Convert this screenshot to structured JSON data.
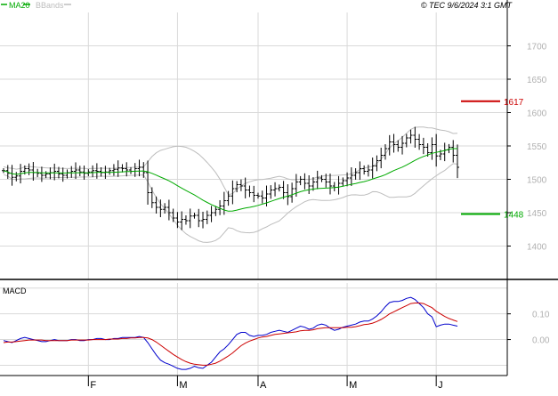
{
  "header": {
    "legend": [
      {
        "label": "MA20",
        "color": "#00aa00"
      },
      {
        "label": "BBands",
        "color": "#bdbdbd"
      }
    ],
    "timestamp": "© TEC 9/6/2024 3:1 GMT"
  },
  "colors": {
    "price": "#000000",
    "ma20": "#00aa00",
    "bands": "#bdbdbd",
    "resistance": "#cc0000",
    "support": "#00aa00",
    "macd_line": "#0000cc",
    "signal_line": "#cc0000",
    "grid": "#d9d9d9"
  },
  "chart_data": [
    {
      "type": "ohlc",
      "ylim": [
        1350,
        1750
      ],
      "yticks": [
        "1400",
        "1450",
        "1500",
        "1550",
        "1600",
        "1650",
        "1700"
      ],
      "xticks": [
        "F",
        "M",
        "A",
        "M",
        "J"
      ],
      "close": [
        1513,
        1509,
        1503,
        1505,
        1512,
        1516,
        1514,
        1510,
        1509,
        1506,
        1508,
        1510,
        1512,
        1508,
        1506,
        1510,
        1512,
        1514,
        1511,
        1509,
        1511,
        1513,
        1512,
        1510,
        1511,
        1513,
        1515,
        1517,
        1516,
        1514,
        1512,
        1516,
        1518,
        1510,
        1480,
        1465,
        1458,
        1455,
        1458,
        1450,
        1442,
        1436,
        1440,
        1438,
        1445,
        1446,
        1438,
        1440,
        1446,
        1450,
        1455,
        1460,
        1468,
        1475,
        1486,
        1492,
        1490,
        1484,
        1480,
        1476,
        1475,
        1472,
        1478,
        1484,
        1486,
        1488,
        1480,
        1474,
        1486,
        1496,
        1500,
        1494,
        1490,
        1496,
        1502,
        1500,
        1496,
        1490,
        1488,
        1494,
        1498,
        1502,
        1506,
        1510,
        1516,
        1512,
        1514,
        1520,
        1528,
        1536,
        1546,
        1556,
        1552,
        1548,
        1554,
        1562,
        1566,
        1560,
        1552,
        1548,
        1540,
        1552,
        1535,
        1538,
        1544,
        1548,
        1536,
        1518
      ],
      "annotations": [
        {
          "label": "1617",
          "value": 1617,
          "color": "#cc0000"
        },
        {
          "label": "1448",
          "value": 1448,
          "color": "#00aa00"
        }
      ],
      "legend": [
        "MA20",
        "BBands"
      ]
    },
    {
      "type": "line",
      "title": "MACD",
      "ylim": [
        -70,
        110
      ],
      "yticks": [
        "0.00",
        "0.10"
      ],
      "series": [
        {
          "values": [
            -2,
            -4,
            -6,
            -2,
            2,
            4,
            2,
            0,
            -2,
            -4,
            -4,
            -2,
            0,
            -2,
            -2,
            -2,
            0,
            0,
            -2,
            -2,
            0,
            0,
            2,
            2,
            0,
            0,
            2,
            2,
            4,
            4,
            4,
            4,
            6,
            4,
            -6,
            -18,
            -30,
            -40,
            -45,
            -48,
            -52,
            -56,
            -58,
            -58,
            -56,
            -52,
            -55,
            -56,
            -50,
            -44,
            -34,
            -24,
            -18,
            -10,
            0,
            10,
            14,
            14,
            8,
            6,
            8,
            8,
            10,
            14,
            16,
            18,
            16,
            14,
            18,
            22,
            26,
            24,
            20,
            22,
            28,
            30,
            28,
            22,
            18,
            20,
            24,
            26,
            28,
            30,
            34,
            36,
            36,
            40,
            46,
            54,
            64,
            72,
            74,
            74,
            76,
            80,
            82,
            78,
            70,
            62,
            50,
            44,
            25,
            28,
            30,
            30,
            28,
            26
          ]
        },
        {
          "values": [
            -6,
            -5,
            -5,
            -4,
            -3,
            -2,
            -1,
            -1,
            -1,
            -1,
            -2,
            -2,
            -2,
            -2,
            -2,
            -2,
            -1,
            -1,
            -1,
            -1,
            -1,
            0,
            0,
            0,
            0,
            1,
            1,
            1,
            2,
            2,
            3,
            3,
            4,
            4,
            3,
            0,
            -5,
            -11,
            -17,
            -23,
            -29,
            -34,
            -39,
            -43,
            -46,
            -48,
            -49,
            -50,
            -50,
            -48,
            -46,
            -42,
            -37,
            -32,
            -26,
            -19,
            -12,
            -7,
            -3,
            0,
            3,
            5,
            6,
            8,
            10,
            11,
            12,
            13,
            14,
            15,
            17,
            18,
            18,
            19,
            21,
            22,
            23,
            23,
            23,
            23,
            23,
            24,
            24,
            25,
            27,
            29,
            30,
            32,
            35,
            39,
            44,
            50,
            54,
            58,
            62,
            66,
            70,
            71,
            71,
            70,
            66,
            62,
            55,
            50,
            45,
            41,
            38,
            35
          ]
        }
      ]
    }
  ]
}
